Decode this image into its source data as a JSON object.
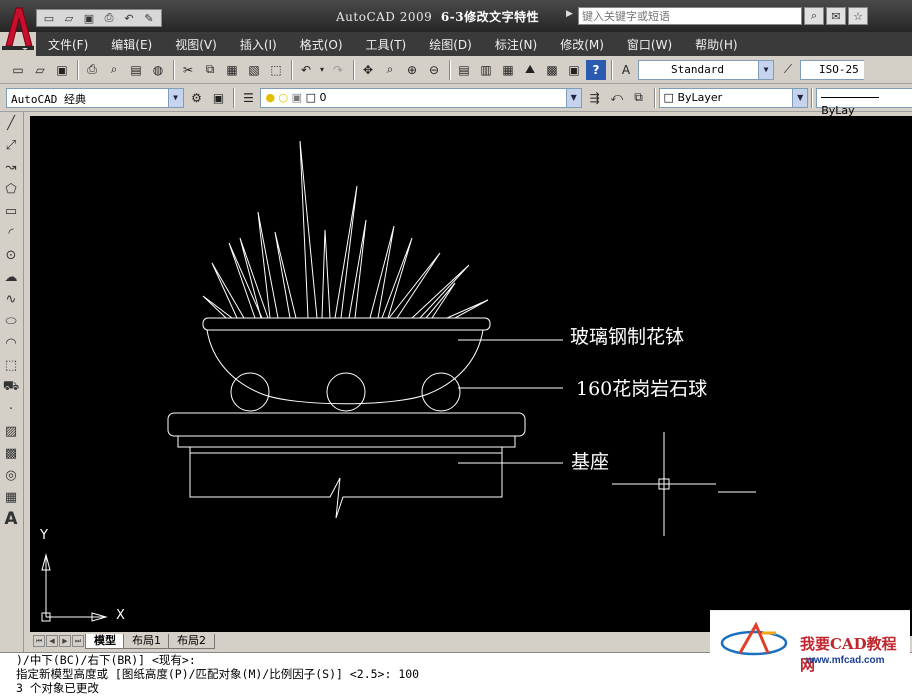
{
  "window": {
    "app_name": "AutoCAD 2009",
    "doc_title": "6-3修改文字特性",
    "search_placeholder": "键入关键字或短语"
  },
  "menu": [
    "文件(F)",
    "编辑(E)",
    "视图(V)",
    "插入(I)",
    "格式(O)",
    "工具(T)",
    "绘图(D)",
    "标注(N)",
    "修改(M)",
    "窗口(W)",
    "帮助(H)"
  ],
  "toolbar": {
    "text_style": "Standard",
    "dim_style": "ISO-25",
    "workspace": "AutoCAD 经典",
    "layer": "0",
    "color": "ByLayer",
    "linetype": "ByLay"
  },
  "drawing": {
    "labels": {
      "bowl": "玻璃钢制花钵",
      "balls": "160花岗岩石球",
      "base": "基座"
    },
    "ucs": {
      "x": "X",
      "y": "Y"
    }
  },
  "tabs": [
    "模型",
    "布局1",
    "布局2"
  ],
  "command_lines": [
    ")/中下(BC)/右下(BR)] <现有>:",
    "指定新模型高度或 [图纸高度(P)/匹配对象(M)/比例因子(S)] <2.5>: 100",
    "3 个对象已更改"
  ],
  "watermark": {
    "brand": "我要CAD教程网",
    "site": "www.mfcad.com"
  },
  "icons": {
    "qat": [
      "new-icon",
      "open-icon",
      "save-icon",
      "print-icon",
      "undo-icon",
      "edit-icon"
    ],
    "title": [
      "search-icon",
      "communication-icon",
      "favorites-icon"
    ]
  },
  "colors": {
    "canvas": "#000000",
    "menubar": "#3a3a3a",
    "logo": "#c8102e"
  }
}
